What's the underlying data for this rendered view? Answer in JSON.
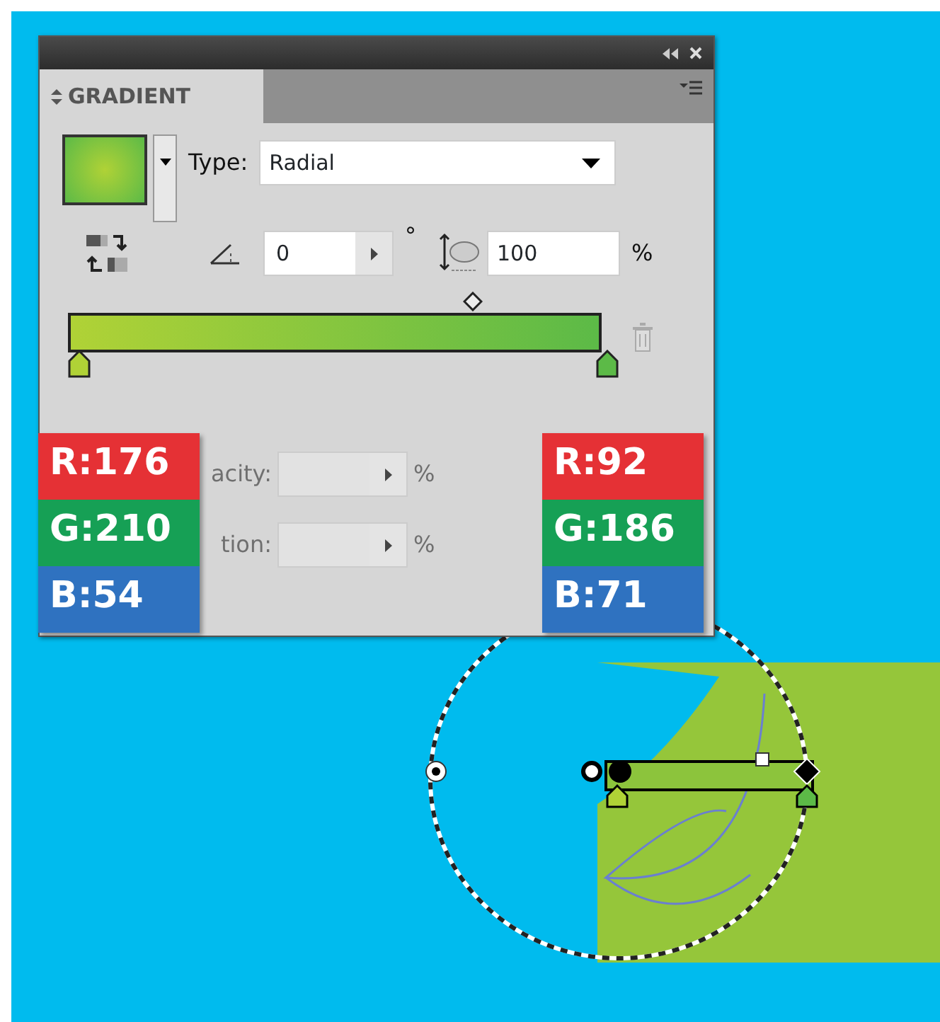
{
  "panel": {
    "title": "GRADIENT",
    "type_label": "Type:",
    "type_value": "Radial",
    "angle": "0",
    "angle_unit": "°",
    "aspect": "100",
    "aspect_unit": "%",
    "fields": [
      {
        "label": "acity:",
        "unit": "%",
        "disabled": true
      },
      {
        "label": "tion:",
        "unit": "%",
        "disabled": true
      }
    ],
    "stops": [
      {
        "color": "#b0d236"
      },
      {
        "color": "#5cba47"
      }
    ]
  },
  "color_labels": [
    {
      "values": [
        "R:176",
        "G:210",
        "B:54"
      ]
    },
    {
      "values": [
        "R:92",
        "G:186",
        "B:71"
      ]
    }
  ]
}
